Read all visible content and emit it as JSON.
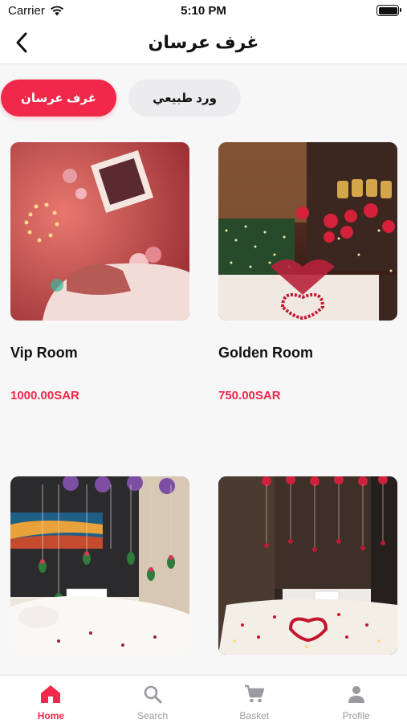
{
  "status_bar": {
    "carrier": "Carrier",
    "time": "5:10 PM"
  },
  "nav": {
    "title": "غرف عرسان",
    "back_icon": "chevron-left-icon"
  },
  "categories": [
    {
      "label": "غرف عرسان",
      "active": true
    },
    {
      "label": "ورد طبيعي",
      "active": false
    }
  ],
  "products": [
    {
      "name": "Golden Room",
      "price": "750.00SAR"
    },
    {
      "name": "Vip Room",
      "price": "1000.00SAR"
    },
    {
      "name": "",
      "price": ""
    },
    {
      "name": "",
      "price": ""
    }
  ],
  "tabs": [
    {
      "label": "Home",
      "icon": "home-icon",
      "active": true
    },
    {
      "label": "Search",
      "icon": "search-icon",
      "active": false
    },
    {
      "label": "Basket",
      "icon": "cart-icon",
      "active": false
    },
    {
      "label": "Profile",
      "icon": "person-icon",
      "active": false
    }
  ],
  "colors": {
    "accent": "#f0284a",
    "inactive_chip": "#ececef",
    "tab_inactive": "#9a9aa0"
  }
}
